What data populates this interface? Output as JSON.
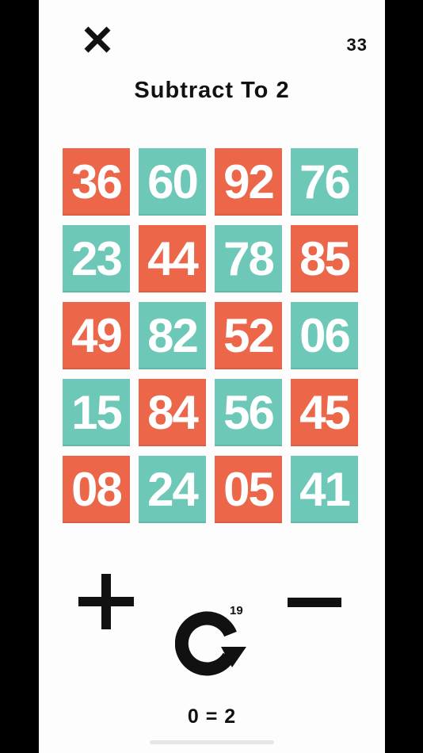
{
  "header": {
    "close_icon": "close-x-icon",
    "score": "33",
    "title": "Subtract To 2"
  },
  "colors": {
    "red": "#ec664a",
    "teal": "#6dc8b8",
    "background": "#fdfdfd",
    "ink": "#111111"
  },
  "grid": {
    "rows": [
      [
        {
          "value": "36",
          "color": "red"
        },
        {
          "value": "60",
          "color": "teal"
        },
        {
          "value": "92",
          "color": "red"
        },
        {
          "value": "76",
          "color": "teal"
        }
      ],
      [
        {
          "value": "23",
          "color": "teal"
        },
        {
          "value": "44",
          "color": "red"
        },
        {
          "value": "78",
          "color": "teal"
        },
        {
          "value": "85",
          "color": "red"
        }
      ],
      [
        {
          "value": "49",
          "color": "red"
        },
        {
          "value": "82",
          "color": "teal"
        },
        {
          "value": "52",
          "color": "red"
        },
        {
          "value": "06",
          "color": "teal"
        }
      ],
      [
        {
          "value": "15",
          "color": "teal"
        },
        {
          "value": "84",
          "color": "red"
        },
        {
          "value": "56",
          "color": "teal"
        },
        {
          "value": "45",
          "color": "red"
        }
      ],
      [
        {
          "value": "08",
          "color": "red"
        },
        {
          "value": "24",
          "color": "teal"
        },
        {
          "value": "05",
          "color": "red"
        },
        {
          "value": "41",
          "color": "teal"
        }
      ]
    ]
  },
  "controls": {
    "plus_icon": "plus-icon",
    "minus_icon": "minus-icon",
    "reset_icon": "refresh-icon",
    "reset_count": "19"
  },
  "footer": {
    "equation": "0 = 2"
  }
}
